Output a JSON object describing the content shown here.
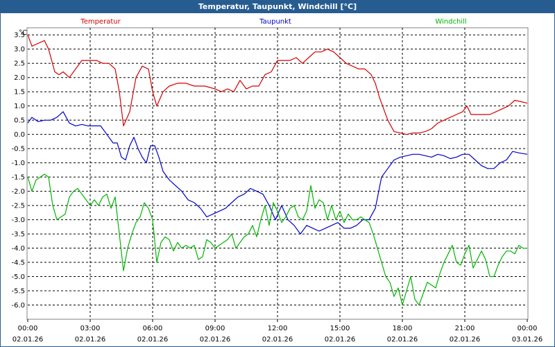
{
  "window": {
    "title": "Temperatur, Taupunkt, Windchill [°C]"
  },
  "chart_data": {
    "type": "line",
    "title": "Temperatur, Taupunkt, Windchill [°C]",
    "ylabel": "°C",
    "xlabel": "",
    "ylim": [
      -6.5,
      3.75
    ],
    "xlim": [
      0,
      24
    ],
    "grid": true,
    "legend_placement": "top",
    "y_ticks": [
      "3.5",
      "3.0",
      "2.5",
      "2.0",
      "1.5",
      "1.0",
      "0.5",
      "0.0",
      "-0.5",
      "-1.0",
      "-1.5",
      "-2.0",
      "-2.5",
      "-3.0",
      "-3.5",
      "-4.0",
      "-4.5",
      "-5.0",
      "-5.5",
      "-6.0"
    ],
    "x_ticks": [
      {
        "time": "00:00",
        "date": "02.01.26",
        "hour": 0
      },
      {
        "time": "03:00",
        "date": "02.01.26",
        "hour": 3
      },
      {
        "time": "06:00",
        "date": "02.01.26",
        "hour": 6
      },
      {
        "time": "09:00",
        "date": "02.01.26",
        "hour": 9
      },
      {
        "time": "12:00",
        "date": "02.01.26",
        "hour": 12
      },
      {
        "time": "15:00",
        "date": "02.01.26",
        "hour": 15
      },
      {
        "time": "18:00",
        "date": "02.01.26",
        "hour": 18
      },
      {
        "time": "21:00",
        "date": "02.01.26",
        "hour": 21
      },
      {
        "time": "00:00",
        "date": "03.01.26",
        "hour": 24
      }
    ],
    "series": [
      {
        "name": "Temperatur",
        "color": "#d40000",
        "x": [
          0,
          0.2,
          0.5,
          0.8,
          1.0,
          1.3,
          1.5,
          1.7,
          2.0,
          2.3,
          2.6,
          3.0,
          3.3,
          3.6,
          3.9,
          4.2,
          4.4,
          4.6,
          4.9,
          5.2,
          5.5,
          5.8,
          6.0,
          6.2,
          6.5,
          6.8,
          7.2,
          7.6,
          8.0,
          8.5,
          9.0,
          9.3,
          9.6,
          9.9,
          10.2,
          10.5,
          10.8,
          11.1,
          11.4,
          11.7,
          12.0,
          12.3,
          12.6,
          12.9,
          13.2,
          13.5,
          13.8,
          14.1,
          14.4,
          14.7,
          15.0,
          15.3,
          15.6,
          15.9,
          16.2,
          16.5,
          16.7,
          16.9,
          17.1,
          17.3,
          17.6,
          17.9,
          18.2,
          18.5,
          18.8,
          19.1,
          19.4,
          19.7,
          20.0,
          20.3,
          20.6,
          20.9,
          21.1,
          21.3,
          21.6,
          21.9,
          22.2,
          22.5,
          22.8,
          23.1,
          23.4,
          23.7,
          24.0
        ],
        "values": [
          3.5,
          3.1,
          3.2,
          3.3,
          3.0,
          2.2,
          2.1,
          2.2,
          2.0,
          2.3,
          2.6,
          2.6,
          2.6,
          2.5,
          2.5,
          2.3,
          1.5,
          0.3,
          0.8,
          2.0,
          2.4,
          2.3,
          1.5,
          1.0,
          1.5,
          1.7,
          1.8,
          1.8,
          1.7,
          1.7,
          1.6,
          1.5,
          1.6,
          1.5,
          1.9,
          1.6,
          1.7,
          1.7,
          2.1,
          2.2,
          2.6,
          2.6,
          2.6,
          2.7,
          2.5,
          2.7,
          2.9,
          2.9,
          3.0,
          2.9,
          2.7,
          2.5,
          2.4,
          2.3,
          2.3,
          2.1,
          1.8,
          1.3,
          0.9,
          0.5,
          0.1,
          0.05,
          0.0,
          0.05,
          0.05,
          0.1,
          0.2,
          0.4,
          0.5,
          0.6,
          0.7,
          0.8,
          1.0,
          0.7,
          0.7,
          0.7,
          0.7,
          0.8,
          0.9,
          1.0,
          1.2,
          1.15,
          1.1
        ]
      },
      {
        "name": "Taupunkt",
        "color": "#0000c8",
        "x": [
          0,
          0.2,
          0.5,
          0.8,
          1.1,
          1.4,
          1.7,
          2.0,
          2.3,
          2.6,
          2.9,
          3.2,
          3.5,
          3.8,
          4.1,
          4.3,
          4.5,
          4.7,
          4.9,
          5.1,
          5.3,
          5.5,
          5.7,
          5.9,
          6.1,
          6.3,
          6.5,
          6.8,
          7.1,
          7.4,
          7.7,
          8.0,
          8.3,
          8.6,
          8.9,
          9.2,
          9.5,
          9.8,
          10.1,
          10.4,
          10.7,
          11.0,
          11.3,
          11.6,
          11.9,
          12.2,
          12.5,
          12.8,
          13.1,
          13.4,
          13.7,
          14.0,
          14.3,
          14.6,
          14.9,
          15.2,
          15.5,
          15.8,
          16.1,
          16.4,
          16.7,
          17.0,
          17.3,
          17.6,
          17.9,
          18.2,
          18.5,
          18.8,
          19.1,
          19.4,
          19.7,
          20.0,
          20.3,
          20.6,
          20.9,
          21.2,
          21.5,
          21.8,
          22.1,
          22.4,
          22.7,
          23.0,
          23.3,
          23.6,
          24.0
        ],
        "values": [
          0.4,
          0.6,
          0.45,
          0.5,
          0.5,
          0.6,
          0.8,
          0.4,
          0.3,
          0.35,
          0.3,
          0.3,
          0.3,
          0.0,
          -0.3,
          -0.3,
          -0.8,
          -0.9,
          -0.4,
          -0.1,
          -0.5,
          -0.8,
          -1.0,
          -0.4,
          -0.4,
          -0.8,
          -1.3,
          -1.6,
          -1.8,
          -2.0,
          -2.3,
          -2.4,
          -2.6,
          -2.9,
          -2.8,
          -2.7,
          -2.6,
          -2.4,
          -2.2,
          -2.1,
          -1.9,
          -2.0,
          -2.1,
          -2.5,
          -3.0,
          -2.5,
          -3.0,
          -3.2,
          -3.5,
          -3.2,
          -3.3,
          -3.4,
          -3.3,
          -3.2,
          -3.1,
          -3.3,
          -3.3,
          -3.2,
          -3.0,
          -3.0,
          -2.6,
          -1.5,
          -1.2,
          -0.9,
          -0.8,
          -0.75,
          -0.7,
          -0.7,
          -0.75,
          -0.8,
          -0.7,
          -0.75,
          -0.85,
          -0.8,
          -0.7,
          -0.7,
          -0.9,
          -1.1,
          -1.2,
          -1.2,
          -1.0,
          -0.9,
          -0.6,
          -0.65,
          -0.7
        ]
      },
      {
        "name": "Windchill",
        "color": "#00b400",
        "x": [
          0,
          0.2,
          0.4,
          0.6,
          0.8,
          1.0,
          1.2,
          1.4,
          1.6,
          1.8,
          2.0,
          2.2,
          2.4,
          2.6,
          2.8,
          3.0,
          3.2,
          3.4,
          3.6,
          3.8,
          4.0,
          4.2,
          4.4,
          4.6,
          4.8,
          5.0,
          5.2,
          5.4,
          5.6,
          5.8,
          6.0,
          6.2,
          6.4,
          6.6,
          6.8,
          7.0,
          7.2,
          7.4,
          7.6,
          7.8,
          8.0,
          8.2,
          8.4,
          8.6,
          8.8,
          9.0,
          9.2,
          9.4,
          9.6,
          9.8,
          10.0,
          10.2,
          10.4,
          10.6,
          10.8,
          11.0,
          11.2,
          11.4,
          11.6,
          11.8,
          12.0,
          12.2,
          12.4,
          12.6,
          12.8,
          13.0,
          13.2,
          13.4,
          13.6,
          13.8,
          14.0,
          14.2,
          14.4,
          14.6,
          14.8,
          15.0,
          15.2,
          15.4,
          15.6,
          15.8,
          16.0,
          16.2,
          16.4,
          16.6,
          16.8,
          17.0,
          17.2,
          17.4,
          17.6,
          17.8,
          18.0,
          18.2,
          18.4,
          18.6,
          18.8,
          19.0,
          19.2,
          19.4,
          19.6,
          19.8,
          20.0,
          20.2,
          20.4,
          20.6,
          20.8,
          21.0,
          21.2,
          21.4,
          21.6,
          21.8,
          22.0,
          22.2,
          22.4,
          22.6,
          22.8,
          23.0,
          23.2,
          23.4,
          23.6,
          23.8,
          24.0
        ],
        "values": [
          -1.5,
          -2.0,
          -1.6,
          -1.5,
          -1.4,
          -1.5,
          -2.5,
          -3.0,
          -2.9,
          -2.8,
          -2.2,
          -2.0,
          -1.9,
          -2.1,
          -2.3,
          -2.5,
          -2.3,
          -2.5,
          -2.2,
          -2.1,
          -2.6,
          -2.2,
          -3.5,
          -4.8,
          -4.0,
          -3.5,
          -3.1,
          -2.9,
          -2.4,
          -2.6,
          -3.0,
          -4.5,
          -3.8,
          -3.6,
          -3.7,
          -4.1,
          -3.8,
          -4.0,
          -3.9,
          -4.0,
          -3.9,
          -4.4,
          -4.3,
          -3.7,
          -3.8,
          -4.0,
          -3.9,
          -3.8,
          -3.7,
          -3.5,
          -4.0,
          -3.8,
          -3.6,
          -3.5,
          -3.2,
          -3.6,
          -3.0,
          -2.5,
          -3.2,
          -2.4,
          -2.7,
          -3.1,
          -2.9,
          -2.6,
          -2.5,
          -2.9,
          -3.0,
          -2.7,
          -1.8,
          -2.6,
          -2.3,
          -2.4,
          -3.0,
          -2.5,
          -3.0,
          -2.7,
          -3.1,
          -2.8,
          -3.0,
          -3.0,
          -2.9,
          -3.0,
          -3.1,
          -3.5,
          -4.0,
          -4.5,
          -5.0,
          -5.2,
          -5.7,
          -5.4,
          -6.0,
          -5.5,
          -5.0,
          -5.8,
          -6.0,
          -5.6,
          -5.2,
          -5.3,
          -5.4,
          -4.9,
          -4.5,
          -4.2,
          -3.9,
          -4.5,
          -4.6,
          -4.2,
          -3.9,
          -4.7,
          -4.4,
          -4.1,
          -4.4,
          -5.0,
          -5.0,
          -4.6,
          -4.3,
          -4.1,
          -4.1,
          -4.2,
          -3.9,
          -4.0,
          -4.0
        ]
      }
    ]
  }
}
